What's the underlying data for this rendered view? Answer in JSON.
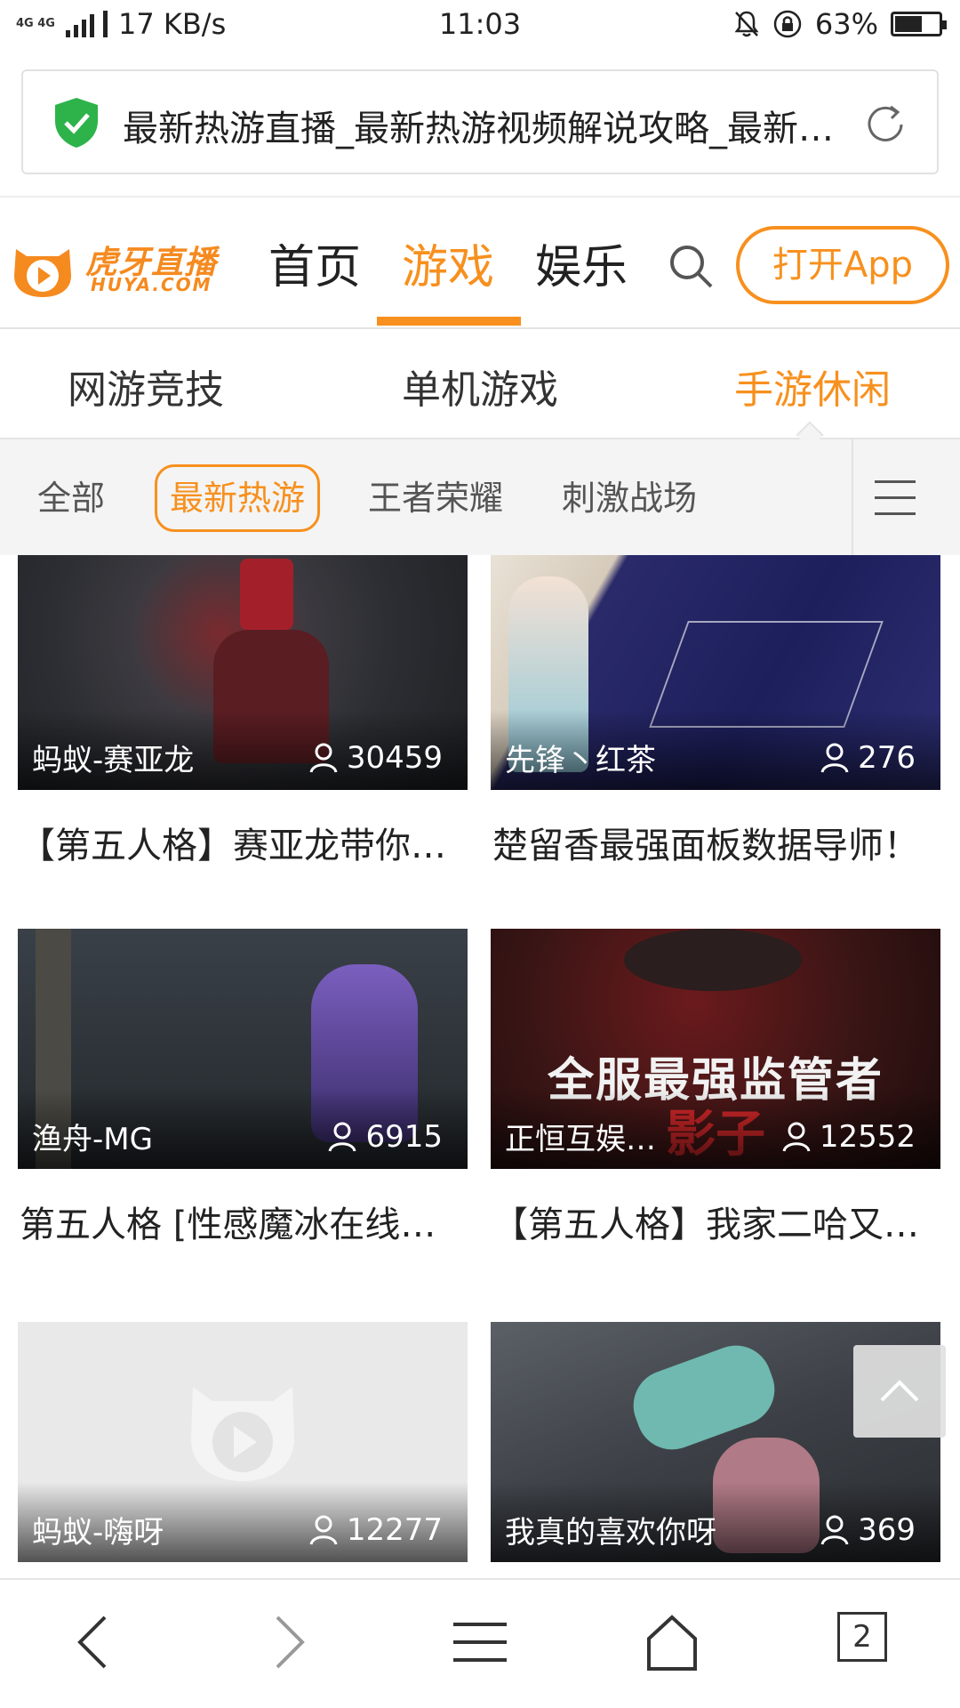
{
  "status_bar": {
    "network": "4G 4G",
    "speed": "17 KB/s",
    "time": "11:03",
    "battery_percent": "63%",
    "battery_level": 0.63
  },
  "address_bar": {
    "title": "最新热游直播_最新热游视频解说攻略_最新热游直播_最新热游视频解说攻略"
  },
  "site_header": {
    "logo_text": "虎牙直播",
    "logo_sub": "HUYA.COM",
    "nav": [
      "首页",
      "游戏",
      "娱乐"
    ],
    "active_nav": "游戏",
    "open_app": "打开App"
  },
  "category_tabs": [
    "网游竞技",
    "单机游戏",
    "手游休闲"
  ],
  "active_category": "手游休闲",
  "sub_filters": [
    "全部",
    "最新热游",
    "王者荣耀",
    "刺激战场"
  ],
  "active_filter": "最新热游",
  "streams": [
    {
      "anchor": "蚂蚁-赛亚龙",
      "viewers": "30459",
      "title": "【第五人格】赛亚龙带你五杀修机"
    },
    {
      "anchor": "先锋丶红茶",
      "viewers": "276",
      "title": "楚留香最强面板数据导师！"
    },
    {
      "anchor": "渔舟-MG",
      "viewers": "6915",
      "title": "第五人格 [性感魔冰在线冠军之路]"
    },
    {
      "anchor": "正恒互娱丶影子",
      "viewers": "12552",
      "title": "【第五人格】我家二哈又开始秀了"
    },
    {
      "anchor": "蚂蚁-嗨呀",
      "viewers": "12277",
      "title": ""
    },
    {
      "anchor": "我真的喜欢你呀",
      "viewers": "369",
      "title": ""
    }
  ],
  "thumb_overlay_text": {
    "line1": "全服最强监管者",
    "line2": "影子"
  },
  "toolbar": {
    "tab_count": "2"
  },
  "colors": {
    "accent": "#f7901e",
    "shield": "#2db34a"
  }
}
